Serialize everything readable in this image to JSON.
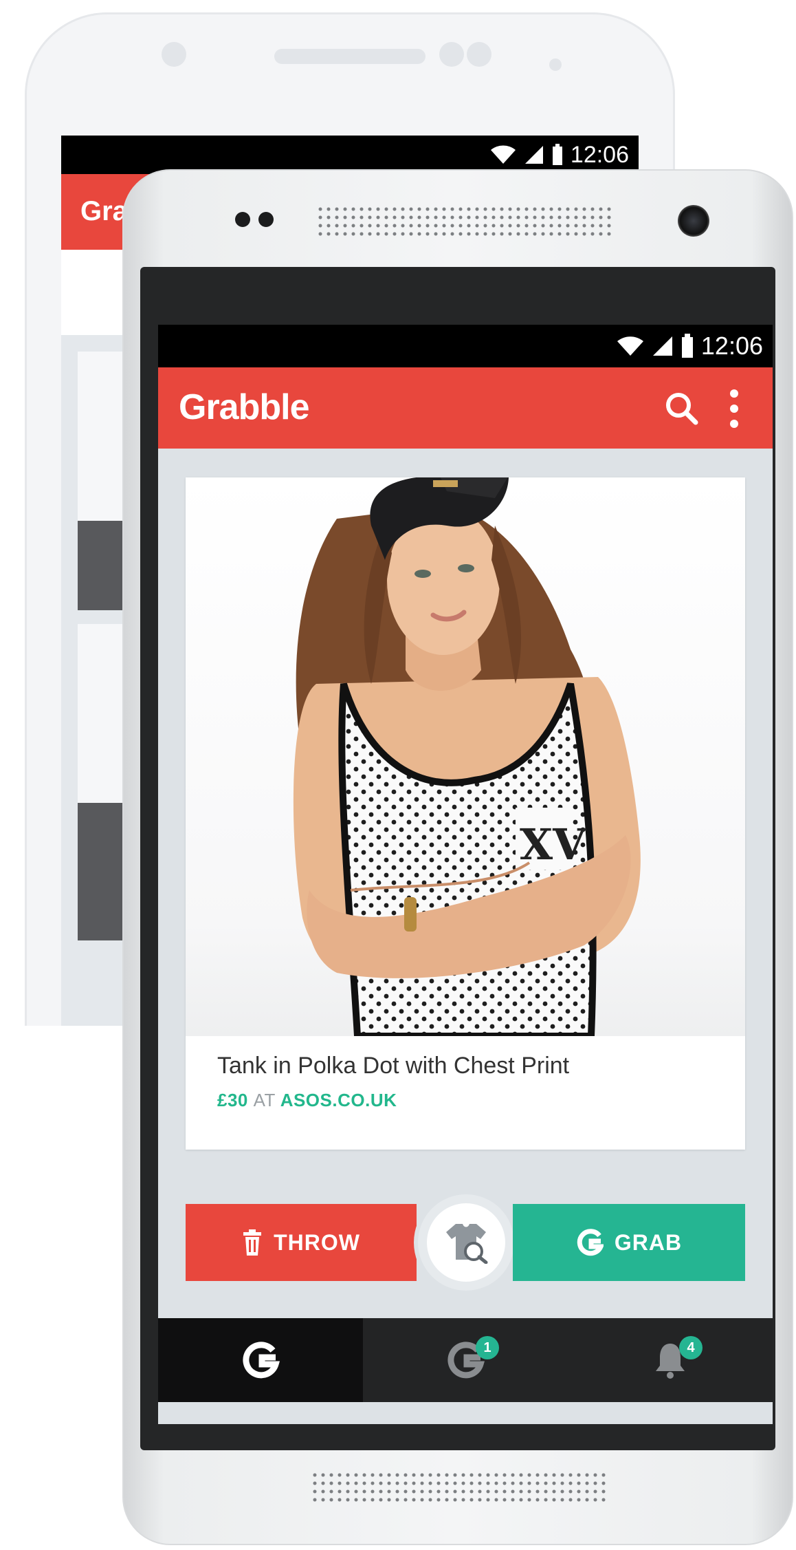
{
  "back_phone": {
    "status_time": "12:06",
    "app_title": "Grab"
  },
  "front_phone": {
    "status_bar": {
      "time": "12:06"
    },
    "appbar": {
      "logo": "Grabble",
      "search_icon": "search-icon",
      "menu_icon": "overflow-menu-icon"
    },
    "card": {
      "image": "model-polka-dot-tank-photo",
      "title": "Tank in Polka Dot with Chest Print",
      "price": "£30",
      "at": "AT",
      "store": "ASOS.CO.UK"
    },
    "actions": {
      "throw_label": "THROW",
      "grab_label": "GRAB",
      "center_icon": "shirt-search-icon"
    },
    "tabs": [
      {
        "icon": "grab-hand-icon",
        "active": true
      },
      {
        "icon": "liked-hand-icon",
        "badge": "1"
      },
      {
        "icon": "bell-icon",
        "badge": "4"
      }
    ],
    "colors": {
      "brand_red": "#e8473d",
      "grab_green": "#25b592"
    }
  }
}
